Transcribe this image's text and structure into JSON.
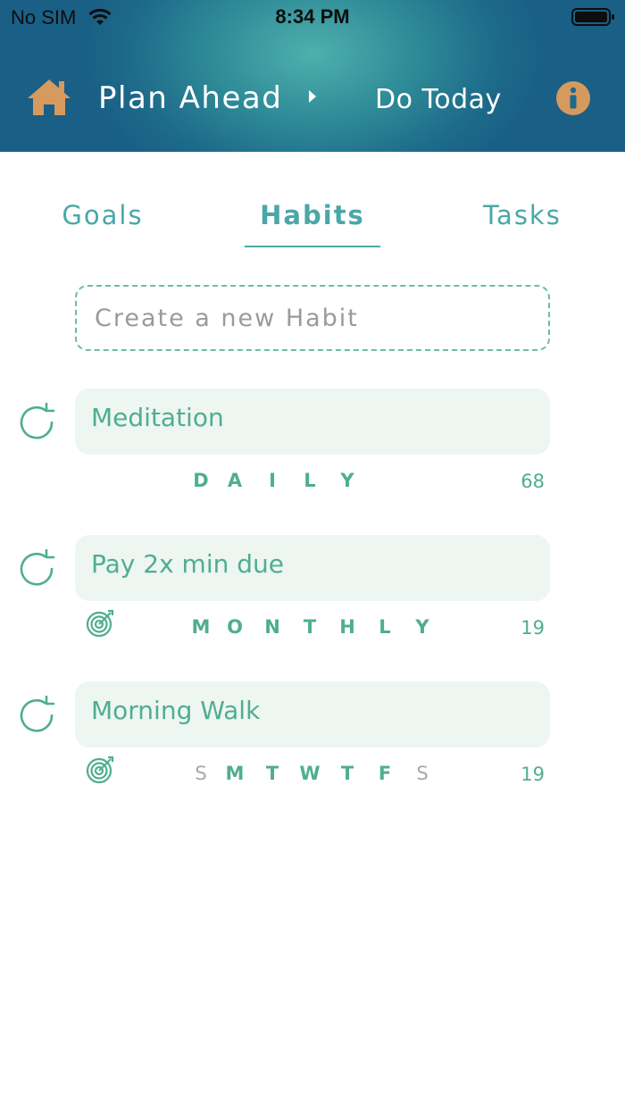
{
  "status_bar": {
    "carrier": "No SIM",
    "time": "8:34 PM",
    "icons": [
      "wifi-icon",
      "battery-icon"
    ]
  },
  "nav": {
    "home_icon": "home-icon",
    "plan_ahead": "Plan Ahead",
    "separator_icon": "triangle-right-icon",
    "do_today": "Do Today",
    "info_icon": "info-icon",
    "accent_color": "#d69a5e"
  },
  "tabs": [
    {
      "label": "Goals",
      "active": false
    },
    {
      "label": "Habits",
      "active": true
    },
    {
      "label": "Tasks",
      "active": false
    }
  ],
  "new_habit": {
    "placeholder": "Create a new Habit"
  },
  "habits": [
    {
      "name": "Meditation",
      "frequency_letters": [
        "D",
        "A",
        "I",
        "L",
        "Y"
      ],
      "count": "68",
      "has_target": false
    },
    {
      "name": "Pay 2x min due",
      "frequency_letters": [
        "M",
        "O",
        "N",
        "T",
        "H",
        "L",
        "Y"
      ],
      "count": "19",
      "has_target": true
    },
    {
      "name": "Morning Walk",
      "weekdays": [
        {
          "letter": "S",
          "active": false
        },
        {
          "letter": "M",
          "active": true
        },
        {
          "letter": "T",
          "active": true
        },
        {
          "letter": "W",
          "active": true
        },
        {
          "letter": "T",
          "active": true
        },
        {
          "letter": "F",
          "active": true
        },
        {
          "letter": "S",
          "active": false
        }
      ],
      "count": "19",
      "has_target": true
    }
  ],
  "colors": {
    "header_dark": "#1a5f86",
    "header_light": "#4fb0ad",
    "teal_text": "#4aa7a8",
    "green_text": "#4fae8f",
    "card_bg": "#eef6f2",
    "muted": "#a8a8a8"
  }
}
